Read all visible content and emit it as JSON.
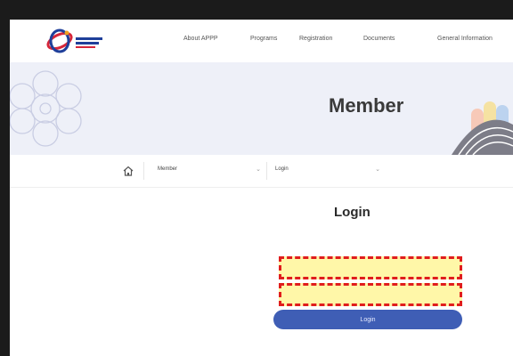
{
  "header": {
    "logo_text": "APPP 20 SINGAPORE",
    "nav": [
      "About APPP",
      "Programs",
      "Registration",
      "Documents",
      "General Information"
    ]
  },
  "banner": {
    "title": "Member"
  },
  "breadcrumb": {
    "home_icon": "home-icon",
    "level1": "Member",
    "level2": "Login"
  },
  "login": {
    "title": "Login",
    "id_value": "",
    "password_value": "",
    "button_label": "Login"
  },
  "colors": {
    "accent": "#3f5eb5",
    "highlight_fill": "#fff7a8",
    "highlight_border": "#e01d1d",
    "banner_bg": "#eef0f8"
  }
}
